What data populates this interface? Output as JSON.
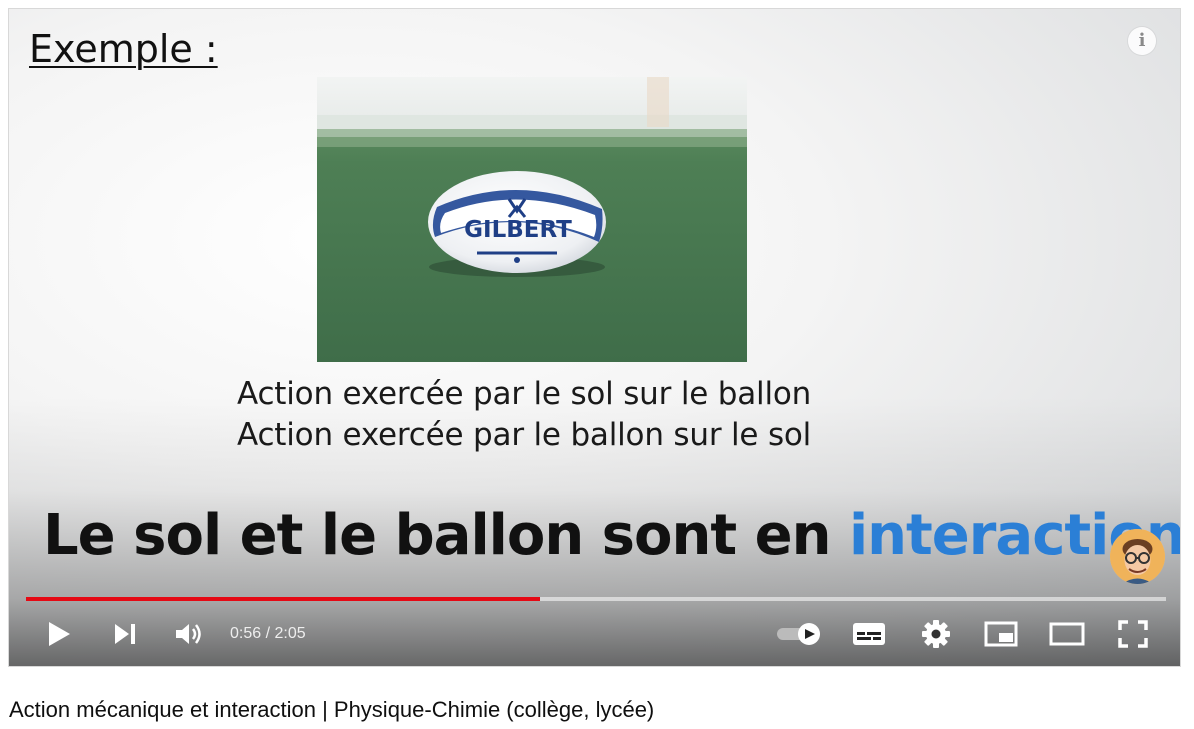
{
  "slide": {
    "title": "Exemple :",
    "line1": "Action exercée par le sol sur le ballon",
    "line2": "Action exercée par le ballon sur le sol",
    "ball_brand": "GILBERT"
  },
  "caption": {
    "text_main": "Le sol et le ballon sont en ",
    "text_highlight": "interaction",
    "highlight_color": "#2b7fd6"
  },
  "player": {
    "time_display": "0:56 / 2:05",
    "progress_fraction": 0.451,
    "progress_color": "#e50914",
    "icons": {
      "info": "info-icon",
      "play": "play-icon",
      "next": "next-icon",
      "volume": "volume-icon",
      "autoplay": "autoplay-toggle-icon",
      "subtitles": "subtitles-icon",
      "settings": "gear-icon",
      "miniplayer": "miniplayer-icon",
      "theater": "theater-mode-icon",
      "fullscreen": "fullscreen-icon"
    }
  },
  "video_title": "Action mécanique et interaction | Physique-Chimie (collège, lycée)"
}
